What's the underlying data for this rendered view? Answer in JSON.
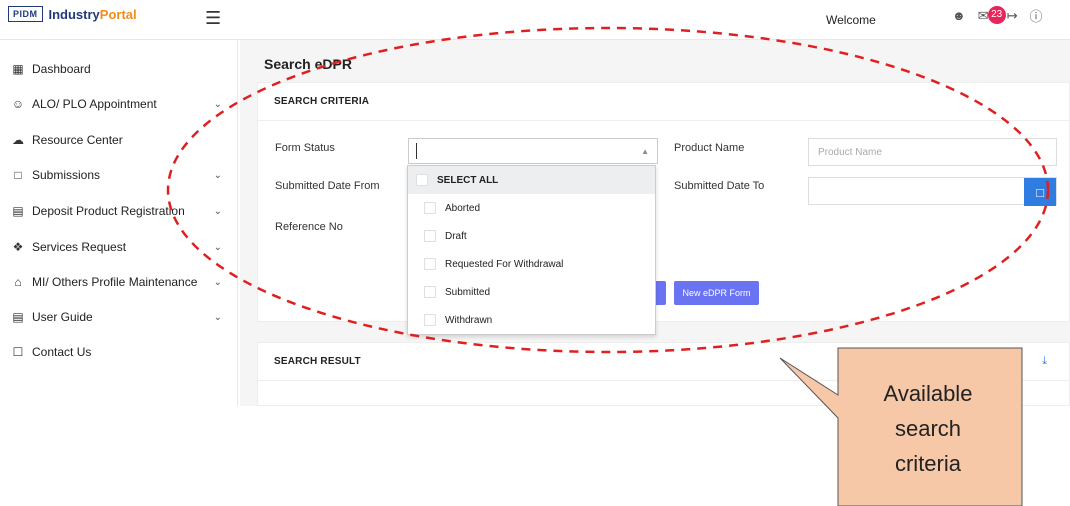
{
  "header": {
    "logo_text": "PIDM",
    "brand_primary": "Industry",
    "brand_accent": "Portal",
    "welcome": "Welcome",
    "notification_count": "23"
  },
  "sidebar": {
    "items": [
      {
        "label": "Dashboard",
        "icon": "dashboard-icon",
        "has_children": false
      },
      {
        "label": "ALO/ PLO Appointment",
        "icon": "user-add-icon",
        "has_children": true
      },
      {
        "label": "Resource Center",
        "icon": "cloud-icon",
        "has_children": false
      },
      {
        "label": "Submissions",
        "icon": "folder-icon",
        "has_children": true
      },
      {
        "label": "Deposit Product Registration",
        "icon": "document-icon",
        "has_children": true
      },
      {
        "label": "Services Request",
        "icon": "services-icon",
        "has_children": true
      },
      {
        "label": "MI/ Others Profile Maintenance",
        "icon": "home-icon",
        "has_children": true
      },
      {
        "label": "User Guide",
        "icon": "book-icon",
        "has_children": true
      },
      {
        "label": "Contact Us",
        "icon": "chat-icon",
        "has_children": false
      }
    ]
  },
  "main": {
    "title": "Search eDPR",
    "criteria_title": "SEARCH CRITERIA",
    "fields": {
      "form_status_label": "Form Status",
      "product_name_label": "Product Name",
      "product_name_placeholder": "Product Name",
      "submitted_from_label": "Submitted Date From",
      "submitted_to_label": "Submitted Date To",
      "reference_no_label": "Reference No"
    },
    "dropdown": {
      "select_all": "SELECT ALL",
      "options": [
        "Aborted",
        "Draft",
        "Requested For Withdrawal",
        "Submitted",
        "Withdrawn"
      ]
    },
    "buttons": {
      "new_form": "New eDPR Form"
    },
    "result_title": "SEARCH RESULT"
  },
  "annotation": {
    "callout_lines": [
      "Available",
      "search",
      "criteria"
    ],
    "color": "#e02020",
    "callout_fill": "#f6c8a8"
  },
  "colors": {
    "brand_navy": "#1f3a7a",
    "brand_orange": "#f08c1a",
    "primary_button": "#6a73f2",
    "calendar_button": "#2f7de1",
    "badge": "#e8245b"
  }
}
